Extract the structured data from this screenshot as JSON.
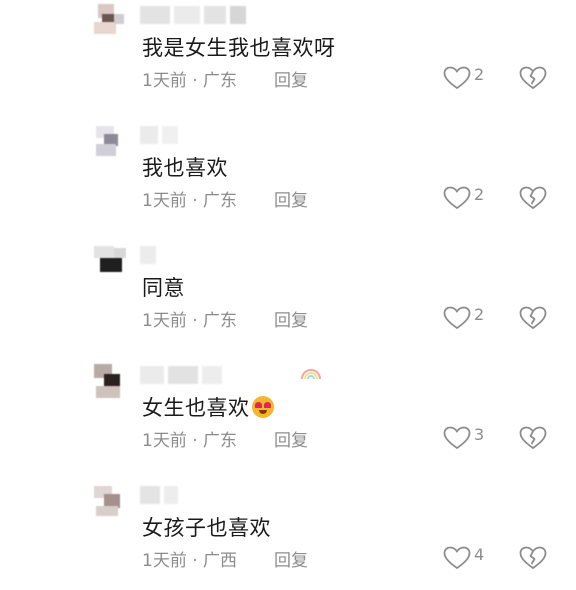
{
  "comments": [
    {
      "text": "我是女生我也喜欢呀",
      "meta": "1天前 · 广东",
      "reply_label": "回复",
      "likes": "2"
    },
    {
      "text": "我也喜欢",
      "meta": "1天前 · 广东",
      "reply_label": "回复",
      "likes": "2"
    },
    {
      "text": "同意",
      "meta": "1天前 · 广东",
      "reply_label": "回复",
      "likes": "2"
    },
    {
      "text": "女生也喜欢",
      "meta": "1天前 · 广东",
      "reply_label": "回复",
      "likes": "3",
      "emoji": "heart-eyes-emoji"
    },
    {
      "text": "女孩子也喜欢",
      "meta": "1天前 · 广西",
      "reply_label": "回复",
      "likes": "4"
    }
  ],
  "icons": {
    "like": "heart-outline-icon",
    "dislike": "broken-heart-icon",
    "avatar": "blurred-avatar",
    "username": "blurred-username"
  },
  "colors": {
    "text": "#1a1a1a",
    "meta": "#8c8c8c",
    "background": "#ffffff"
  }
}
